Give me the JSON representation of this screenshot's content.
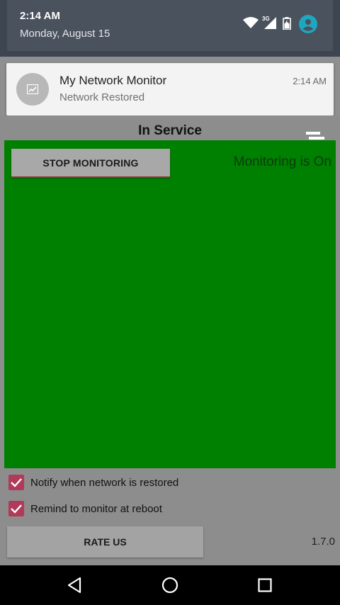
{
  "status_shade": {
    "time": "2:14 AM",
    "date": "Monday, August 15",
    "icons": [
      "wifi-icon",
      "cellular-3g-icon",
      "battery-icon",
      "account-icon"
    ],
    "network_type": "3G"
  },
  "notification": {
    "app_name": "My Network Monitor",
    "message": "Network Restored",
    "time": "2:14 AM",
    "icon": "network-monitor-icon"
  },
  "app": {
    "title": "In Service",
    "menu_icon": "sort-menu-icon",
    "stop_button_label": "STOP MONITORING",
    "monitor_status": "Monitoring is On",
    "panel_color": "#008000",
    "checkboxes": [
      {
        "label": "Notify when network is restored",
        "checked": true
      },
      {
        "label": "Remind to monitor at reboot",
        "checked": true
      }
    ],
    "rate_button_label": "RATE US",
    "version": "1.7.0",
    "accent_color": "#b13a5a"
  },
  "navbar": {
    "buttons": [
      "back-icon",
      "home-icon",
      "recents-icon"
    ]
  }
}
